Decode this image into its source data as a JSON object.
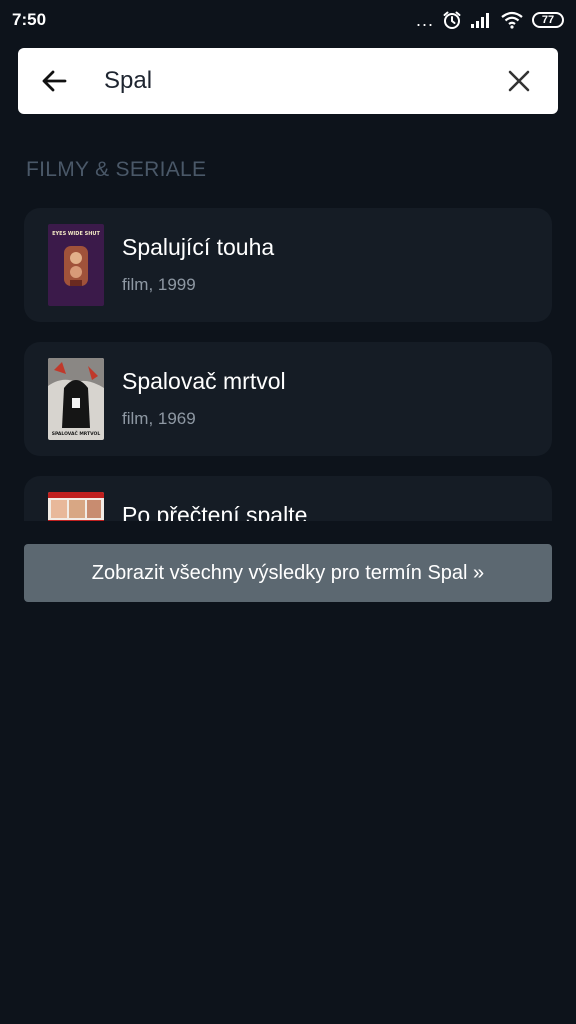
{
  "status_bar": {
    "time": "7:50",
    "battery": "77",
    "dots": "..."
  },
  "search": {
    "value": "Spal"
  },
  "section": {
    "heading": "FILMY & SERIALE"
  },
  "results": [
    {
      "title": "Spalující touha",
      "subtitle": "film, 1999",
      "poster_text": "EYES WIDE SHUT"
    },
    {
      "title": "Spalovač mrtvol",
      "subtitle": "film, 1969",
      "poster_text": "SPALOVAČ MRTVOL"
    },
    {
      "title": "Po přečtení spalte",
      "subtitle": ""
    }
  ],
  "show_all": {
    "label": "Zobrazit všechny výsledky pro termín Spal »"
  },
  "colors": {
    "background": "#0d131b",
    "card": "#151c25",
    "button": "#5c6871",
    "heading": "#4a5868",
    "subtitle": "#8e98a3"
  }
}
